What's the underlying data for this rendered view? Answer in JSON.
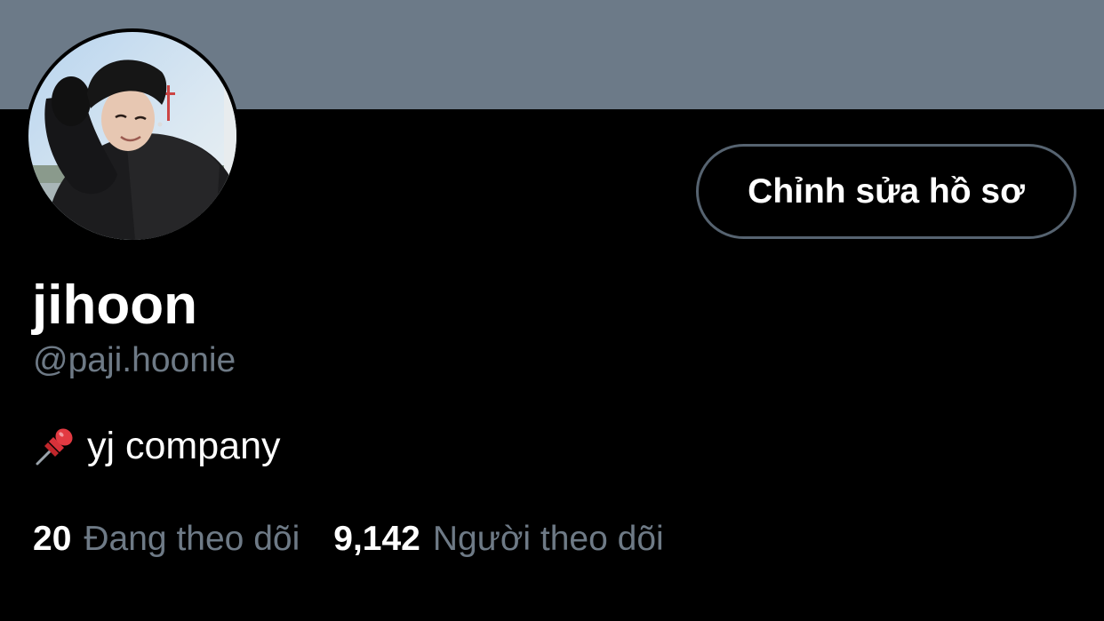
{
  "profile": {
    "banner_color": "#6c7a88",
    "display_name": "jihoon",
    "handle": "@paji.hoonie",
    "bio_icon": "pushpin-icon",
    "bio": "yj company",
    "avatar_alt": "profile photo"
  },
  "actions": {
    "edit_profile_label": "Chỉnh sửa hồ sơ"
  },
  "stats": {
    "following_count": "20",
    "following_label": "Đang theo dõi",
    "followers_count": "9,142",
    "followers_label": "Người theo dõi"
  },
  "colors": {
    "background": "#000000",
    "primary_text": "#ffffff",
    "secondary_text": "#6e7a86",
    "button_border": "#566370"
  }
}
